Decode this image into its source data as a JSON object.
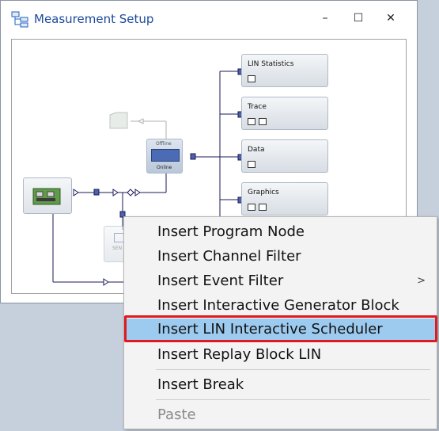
{
  "window": {
    "title": "Measurement Setup",
    "minimize": "–",
    "maximize": "☐",
    "close": "✕"
  },
  "canvas": {
    "blocks": [
      {
        "id": "lin-statistics",
        "label": "LIN Statistics"
      },
      {
        "id": "trace",
        "label": "Trace"
      },
      {
        "id": "data",
        "label": "Data"
      },
      {
        "id": "graphics",
        "label": "Graphics"
      }
    ],
    "switch": {
      "top_label": "Offline",
      "bottom_label": "Online"
    },
    "partial_block_label": "SEN"
  },
  "context_menu": {
    "items": [
      {
        "label": "Insert Program Node",
        "enabled": true
      },
      {
        "label": "Insert Channel Filter",
        "enabled": true
      },
      {
        "label": "Insert Event Filter",
        "enabled": true,
        "submenu": ">"
      },
      {
        "label": "Insert Interactive Generator Block",
        "enabled": true
      },
      {
        "label": "Insert LIN Interactive Scheduler",
        "enabled": true,
        "selected": true
      },
      {
        "label": "Insert Replay Block LIN",
        "enabled": true
      },
      {
        "label": "Insert Break",
        "enabled": true
      },
      {
        "label": "Paste",
        "enabled": false
      }
    ]
  },
  "colors": {
    "accent_highlight": "#e0191f",
    "selection": "#9dcbf0",
    "title_text": "#1b4a9c"
  }
}
